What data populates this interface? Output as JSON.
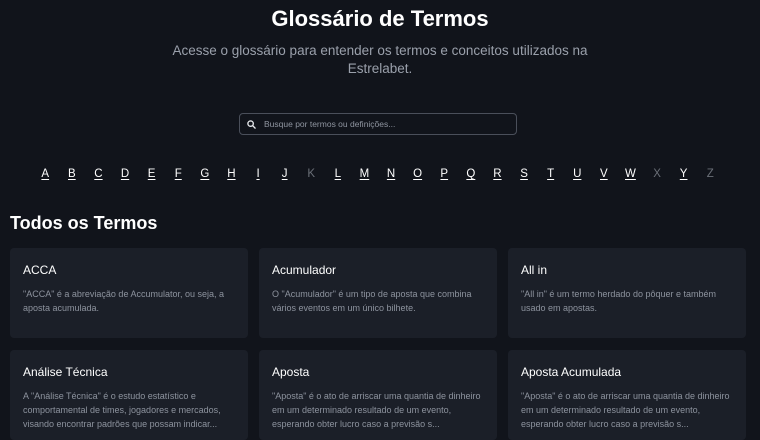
{
  "header": {
    "title": "Glossário de Termos",
    "subtitle": "Acesse o glossário para entender os termos e conceitos utilizados na Estrelabet."
  },
  "search": {
    "placeholder": "Busque por termos ou definições...",
    "icon": "search-icon"
  },
  "alphabet": [
    {
      "letter": "A",
      "enabled": true
    },
    {
      "letter": "B",
      "enabled": true
    },
    {
      "letter": "C",
      "enabled": true
    },
    {
      "letter": "D",
      "enabled": true
    },
    {
      "letter": "E",
      "enabled": true
    },
    {
      "letter": "F",
      "enabled": true
    },
    {
      "letter": "G",
      "enabled": true
    },
    {
      "letter": "H",
      "enabled": true
    },
    {
      "letter": "I",
      "enabled": true
    },
    {
      "letter": "J",
      "enabled": true
    },
    {
      "letter": "K",
      "enabled": false
    },
    {
      "letter": "L",
      "enabled": true
    },
    {
      "letter": "M",
      "enabled": true
    },
    {
      "letter": "N",
      "enabled": true
    },
    {
      "letter": "O",
      "enabled": true
    },
    {
      "letter": "P",
      "enabled": true
    },
    {
      "letter": "Q",
      "enabled": true
    },
    {
      "letter": "R",
      "enabled": true
    },
    {
      "letter": "S",
      "enabled": true
    },
    {
      "letter": "T",
      "enabled": true
    },
    {
      "letter": "U",
      "enabled": true
    },
    {
      "letter": "V",
      "enabled": true
    },
    {
      "letter": "W",
      "enabled": true
    },
    {
      "letter": "X",
      "enabled": false
    },
    {
      "letter": "Y",
      "enabled": true
    },
    {
      "letter": "Z",
      "enabled": false
    }
  ],
  "section": {
    "title": "Todos os Termos"
  },
  "terms": [
    {
      "title": "ACCA",
      "description": "\"ACCA\" é a abreviação de Accumulator, ou seja, a aposta acumulada."
    },
    {
      "title": "Acumulador",
      "description": "O \"Acumulador\" é um tipo de aposta que combina vários eventos em um único bilhete."
    },
    {
      "title": "All in",
      "description": "\"All in\" é um termo herdado do pôquer e também usado em apostas."
    },
    {
      "title": "Análise Técnica",
      "description": "A \"Análise Técnica\" é o estudo estatístico e comportamental de times, jogadores e mercados, visando encontrar padrões que possam indicar..."
    },
    {
      "title": "Aposta",
      "description": "\"Aposta\" é o ato de arriscar uma quantia de dinheiro em um determinado resultado de um evento, esperando obter lucro caso a previsão s..."
    },
    {
      "title": "Aposta Acumulada",
      "description": "\"Aposta\" é o ato de arriscar uma quantia de dinheiro em um determinado resultado de um evento, esperando obter lucro caso a previsão s..."
    }
  ],
  "colors": {
    "background": "#11141b",
    "card": "#1b1f28",
    "muted_text": "#8d939e",
    "disabled_letter": "#6b7078"
  }
}
